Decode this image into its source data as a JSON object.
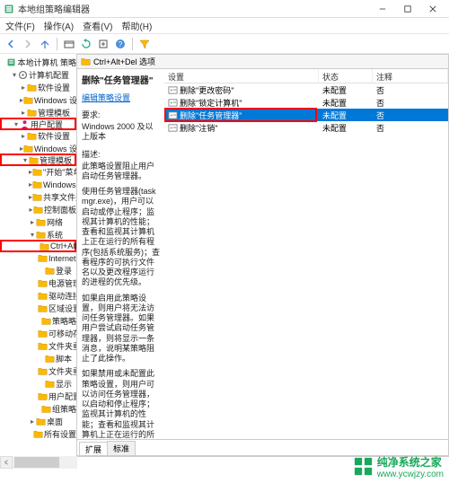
{
  "window": {
    "title": "本地组策略编辑器"
  },
  "menu": {
    "file": "文件(F)",
    "action": "操作(A)",
    "view": "查看(V)",
    "help": "帮助(H)"
  },
  "toolbar_icons": {
    "back": "back-icon",
    "forward": "forward-icon",
    "up": "up-icon",
    "show": "show-icon",
    "refresh": "refresh-icon",
    "export": "export-icon",
    "help": "help-icon",
    "filter": "filter-icon"
  },
  "tree": [
    {
      "level": 0,
      "tw": "",
      "icon": "policy",
      "label": "本地计算机 策略"
    },
    {
      "level": 1,
      "tw": "▾",
      "icon": "gear",
      "label": "计算机配置"
    },
    {
      "level": 2,
      "tw": "▸",
      "icon": "folder",
      "label": "软件设置"
    },
    {
      "level": 2,
      "tw": "▸",
      "icon": "folder",
      "label": "Windows 设置"
    },
    {
      "level": 2,
      "tw": "▸",
      "icon": "folder",
      "label": "管理模板"
    },
    {
      "level": 1,
      "tw": "▾",
      "icon": "person",
      "label": "用户配置",
      "red": true
    },
    {
      "level": 2,
      "tw": "▸",
      "icon": "folder",
      "label": "软件设置"
    },
    {
      "level": 2,
      "tw": "▸",
      "icon": "folder",
      "label": "Windows 设置"
    },
    {
      "level": 2,
      "tw": "▾",
      "icon": "folder",
      "label": "管理模板",
      "red": true
    },
    {
      "level": 3,
      "tw": "▸",
      "icon": "folder",
      "label": "\"开始\"菜单和"
    },
    {
      "level": 3,
      "tw": "▸",
      "icon": "folder",
      "label": "Windows 组"
    },
    {
      "level": 3,
      "tw": "▸",
      "icon": "folder",
      "label": "共享文件夹"
    },
    {
      "level": 3,
      "tw": "▸",
      "icon": "folder",
      "label": "控制面板"
    },
    {
      "level": 3,
      "tw": "▸",
      "icon": "folder",
      "label": "网络"
    },
    {
      "level": 3,
      "tw": "▾",
      "icon": "folder",
      "label": "系统"
    },
    {
      "level": 4,
      "tw": "",
      "icon": "folder",
      "label": "Ctrl+Alt+",
      "red": true
    },
    {
      "level": 4,
      "tw": "",
      "icon": "folder",
      "label": "Internet 道"
    },
    {
      "level": 4,
      "tw": "",
      "icon": "folder",
      "label": "登录"
    },
    {
      "level": 4,
      "tw": "",
      "icon": "folder",
      "label": "电源管理"
    },
    {
      "level": 4,
      "tw": "",
      "icon": "folder",
      "label": "驱动连接"
    },
    {
      "level": 4,
      "tw": "",
      "icon": "folder",
      "label": "区域设置服"
    },
    {
      "level": 4,
      "tw": "",
      "icon": "folder",
      "label": "策略略"
    },
    {
      "level": 4,
      "tw": "",
      "icon": "folder",
      "label": "可移动存储"
    },
    {
      "level": 4,
      "tw": "",
      "icon": "folder",
      "label": "文件夹重定"
    },
    {
      "level": 4,
      "tw": "",
      "icon": "folder",
      "label": "脚本"
    },
    {
      "level": 4,
      "tw": "",
      "icon": "folder",
      "label": "文件夹重定"
    },
    {
      "level": 4,
      "tw": "",
      "icon": "folder",
      "label": "显示"
    },
    {
      "level": 4,
      "tw": "",
      "icon": "folder",
      "label": "用户配置文"
    },
    {
      "level": 4,
      "tw": "",
      "icon": "folder",
      "label": "组策略"
    },
    {
      "level": 3,
      "tw": "▸",
      "icon": "folder",
      "label": "桌面"
    },
    {
      "level": 3,
      "tw": "",
      "icon": "folder",
      "label": "所有设置"
    }
  ],
  "breadcrumb": {
    "label": "Ctrl+Alt+Del 选项"
  },
  "description": {
    "title": "删除\"任务管理器\"",
    "edit_link": "编辑策略设置",
    "req_label": "要求:",
    "req_value": "Windows 2000 及以上版本",
    "desc_label": "描述:",
    "p1": "此策略设置阻止用户启动任务管理器。",
    "p2": "使用任务管理器(taskmgr.exe)，用户可以启动或停止程序；监视其计算机的性能；查看和监视其计算机上正在运行的所有程序(包括系统服务)；查看程序的可执行文件名以及更改程序运行的进程的优先级。",
    "p3": "如果启用此策略设置，则用户将无法访问任务管理器。如果用户尝试启动任务管理器，则将显示一条消息，说明某策略阻止了此操作。",
    "p4": "如果禁用或未配置此策略设置，则用户可以访问任务管理器，以启动和停止程序；监视其计算机的性能；查看和监视其计算机上正在运行的所有程序(包括系统服务)；查找程序的可执行文件名以及更改程序所运行的进程的优先级。"
  },
  "list": {
    "headers": {
      "setting": "设置",
      "status": "状态",
      "comment": "注释"
    },
    "rows": [
      {
        "setting": "删除\"更改密码\"",
        "status": "未配置",
        "comment": "否",
        "selected": false
      },
      {
        "setting": "删除\"锁定计算机\"",
        "status": "未配置",
        "comment": "否",
        "selected": false
      },
      {
        "setting": "删除\"任务管理器\"",
        "status": "未配置",
        "comment": "否",
        "selected": true
      },
      {
        "setting": "删除\"注销\"",
        "status": "未配置",
        "comment": "否",
        "selected": false
      }
    ]
  },
  "tabs": {
    "extended": "扩展",
    "standard": "标准"
  },
  "watermark": {
    "name": "纯净系统之家",
    "url": "www.ycwjzy.com"
  }
}
